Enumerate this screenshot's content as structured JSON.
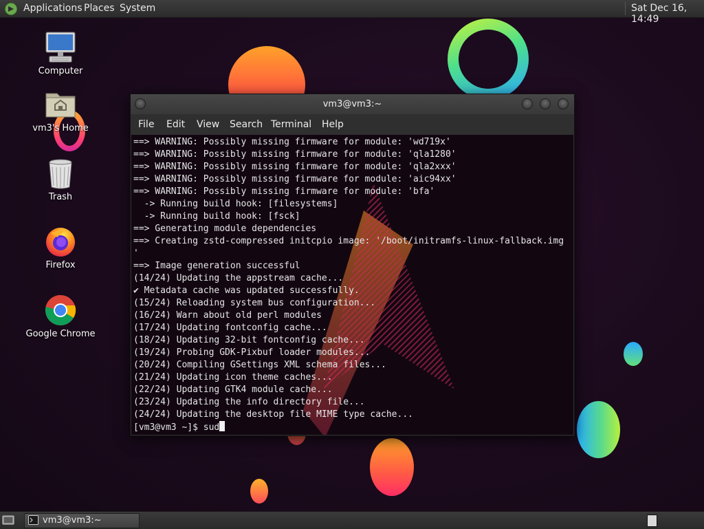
{
  "top_panel": {
    "menus": [
      "Applications",
      "Places",
      "System"
    ],
    "clock": "Sat Dec 16, 14:49"
  },
  "desktop_icons": [
    {
      "label": "Computer",
      "icon": "computer-icon"
    },
    {
      "label": "vm3's Home",
      "icon": "home-folder-icon"
    },
    {
      "label": "Trash",
      "icon": "trash-icon"
    },
    {
      "label": "Firefox",
      "icon": "firefox-icon"
    },
    {
      "label": "Google Chrome",
      "icon": "chrome-icon"
    }
  ],
  "terminal": {
    "title": "vm3@vm3:~",
    "menu": [
      "File",
      "Edit",
      "View",
      "Search",
      "Terminal",
      "Help"
    ],
    "lines": [
      "==> WARNING: Possibly missing firmware for module: 'wd719x'",
      "==> WARNING: Possibly missing firmware for module: 'qla1280'",
      "==> WARNING: Possibly missing firmware for module: 'qla2xxx'",
      "==> WARNING: Possibly missing firmware for module: 'aic94xx'",
      "==> WARNING: Possibly missing firmware for module: 'bfa'",
      "  -> Running build hook: [filesystems]",
      "  -> Running build hook: [fsck]",
      "==> Generating module dependencies",
      "==> Creating zstd-compressed initcpio image: '/boot/initramfs-linux-fallback.img",
      "'",
      "==> Image generation successful",
      "(14/24) Updating the appstream cache...",
      "✔ Metadata cache was updated successfully.",
      "(15/24) Reloading system bus configuration...",
      "(16/24) Warn about old perl modules",
      "(17/24) Updating fontconfig cache...",
      "(18/24) Updating 32-bit fontconfig cache...",
      "(19/24) Probing GDK-Pixbuf loader modules...",
      "(20/24) Compiling GSettings XML schema files...",
      "(21/24) Updating icon theme caches...",
      "(22/24) Updating GTK4 module cache...",
      "(23/24) Updating the info directory file...",
      "(24/24) Updating the desktop file MIME type cache..."
    ],
    "prompt": "[vm3@vm3 ~]$ ",
    "input": "sud"
  },
  "taskbar": {
    "window_button": "vm3@vm3:~",
    "show_desktop_icon": "show-desktop-icon",
    "workspace_icon": "workspace-switcher-icon"
  }
}
